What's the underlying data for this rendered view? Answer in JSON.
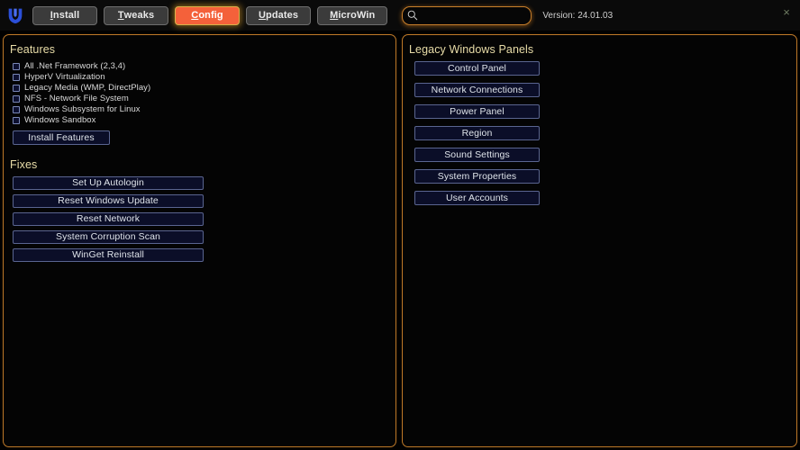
{
  "window": {
    "logo_icon": "winutil-shield-icon",
    "close_label": "×",
    "close_icon": "close-icon"
  },
  "topbar": {
    "tabs": [
      {
        "label": "Install",
        "accel": "I",
        "rest": "nstall",
        "active": false
      },
      {
        "label": "Tweaks",
        "accel": "T",
        "rest": "weaks",
        "active": false
      },
      {
        "label": "Config",
        "accel": "C",
        "rest": "onfig",
        "active": true
      },
      {
        "label": "Updates",
        "accel": "U",
        "rest": "pdates",
        "active": false
      },
      {
        "label": "MicroWin",
        "accel": "M",
        "rest": "icroWin",
        "active": false
      }
    ],
    "search": {
      "value": "",
      "placeholder": "",
      "icon": "search-icon"
    },
    "version_text": "Version: 24.01.03"
  },
  "left_panel": {
    "features": {
      "heading": "Features",
      "items": [
        {
          "label": "All .Net Framework (2,3,4)",
          "checked": false
        },
        {
          "label": "HyperV Virtualization",
          "checked": false
        },
        {
          "label": "Legacy Media (WMP, DirectPlay)",
          "checked": false
        },
        {
          "label": "NFS - Network File System",
          "checked": false
        },
        {
          "label": "Windows Subsystem for Linux",
          "checked": false
        },
        {
          "label": "Windows Sandbox",
          "checked": false
        }
      ],
      "install_button": "Install Features"
    },
    "fixes": {
      "heading": "Fixes",
      "buttons": [
        "Set Up Autologin",
        "Reset Windows Update",
        "Reset Network",
        "System Corruption Scan",
        "WinGet Reinstall"
      ]
    }
  },
  "right_panel": {
    "heading": "Legacy Windows Panels",
    "buttons": [
      "Control Panel",
      "Network Connections",
      "Power Panel",
      "Region",
      "Sound Settings",
      "System Properties",
      "User Accounts"
    ]
  },
  "colors": {
    "background": "#000000",
    "panel_border": "#c07a28",
    "accent_active_tab": "#f4613a",
    "active_tab_glow": "#d8b24a",
    "heading_text": "#e8dca8",
    "button_fill": "#0b0e28",
    "button_border": "#5a6590",
    "search_border": "#c87f2a"
  }
}
